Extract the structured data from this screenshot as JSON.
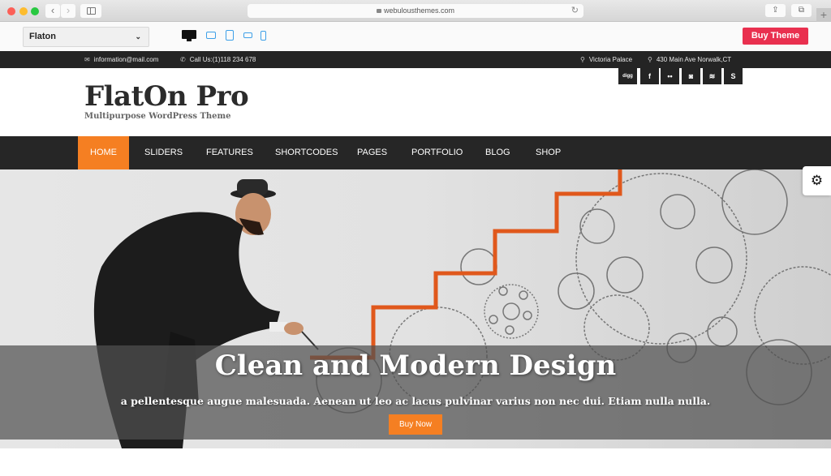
{
  "browser": {
    "url": "webulousthemes.com",
    "back_label": "‹",
    "forward_label": "›",
    "reload_label": "↻",
    "share_label": "⇪",
    "tabs_label": "⧉",
    "newtab_label": "+"
  },
  "demobar": {
    "theme_selected": "Flaton",
    "select_chevron": "⌄",
    "devices": [
      "desktop",
      "tablet-landscape",
      "tablet-portrait",
      "phone-landscape",
      "phone-portrait"
    ],
    "buy_theme_label": "Buy Theme",
    "buy_theme_color": "#e9304f"
  },
  "topbar": {
    "email": "information@mail.com",
    "phone": "Call Us:(1)118 234 678",
    "location1": "Victoria Palace",
    "location2": "430 Main Ave Norwalk,CT",
    "email_icon": "✉",
    "phone_icon": "✆",
    "pin_icon": "⚲"
  },
  "social": [
    {
      "name": "digg",
      "glyph": "digg"
    },
    {
      "name": "facebook",
      "glyph": "f"
    },
    {
      "name": "flickr",
      "glyph": "••"
    },
    {
      "name": "instagram",
      "glyph": "◙"
    },
    {
      "name": "rss",
      "glyph": "≋"
    },
    {
      "name": "skype",
      "glyph": "S"
    }
  ],
  "header": {
    "logo": "FlatOn Pro",
    "tagline": "Multipurpose WordPress Theme"
  },
  "nav": {
    "items": [
      "HOME",
      "SLIDERS",
      "FEATURES",
      "SHORTCODES",
      "PAGES",
      "PORTFOLIO",
      "BLOG",
      "SHOP"
    ],
    "active": "HOME",
    "accent": "#f57f22"
  },
  "hero": {
    "title": "Clean and Modern Design",
    "subtitle": "a pellentesque augue malesuada. Aenean ut leo ac lacus pulvinar varius non nec dui. Etiam nulla nulla.",
    "button_label": "Buy Now"
  },
  "settings_panel": {
    "icon": "⚙"
  }
}
